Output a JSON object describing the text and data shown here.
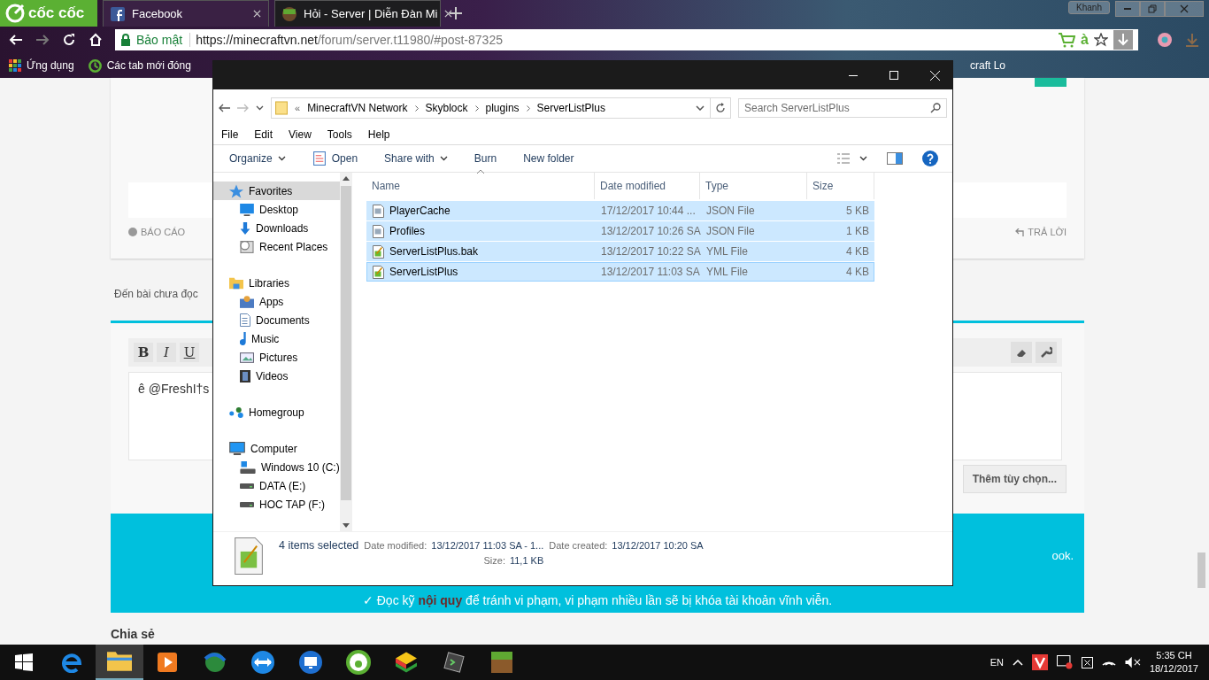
{
  "browser": {
    "brand": "cốc cốc",
    "tabs": [
      {
        "label": "Facebook",
        "kind": "facebook",
        "selected": false
      },
      {
        "label": "Hỏi - Server | Diễn Đàn Mi",
        "kind": "grass",
        "selected": true
      }
    ],
    "user": "Khanh",
    "security_label": "Bảo mật",
    "url_host": "https://minecraftvn.net",
    "url_path": "/forum/server.t11980/#post-87325",
    "addon_text": "à",
    "bookmarks": [
      {
        "label": "Ứng dụng",
        "kind": "apps"
      },
      {
        "label": "Các tab mới đóng",
        "kind": "history"
      },
      {
        "label": "craft Lo",
        "kind": "plain"
      }
    ]
  },
  "page": {
    "report": "BÁO CÁO",
    "reply": "TRẢ LỜI",
    "unread": "Đến bài chưa đọc",
    "editor_buttons": [
      "B",
      "I",
      "U"
    ],
    "editor_text": "ê @FreshI†s",
    "more_options": "Thêm tùy chọn...",
    "notice_tail": "ook.",
    "rules": "✓ Đọc kỹ **nội quy** để tránh vi phạm, vi phạm nhiều lần sẽ bị khóa tài khoản vĩnh viễn.",
    "share": "Chia sẻ"
  },
  "explorer": {
    "breadcrumb_prefix": "«",
    "breadcrumb": [
      "MinecraftVN Network",
      "Skyblock",
      "plugins",
      "ServerListPlus"
    ],
    "search": {
      "placeholder": "Search ServerListPlus"
    },
    "menu": [
      "File",
      "Edit",
      "View",
      "Tools",
      "Help"
    ],
    "toolbar": [
      {
        "label": "Organize",
        "dropdown": true,
        "kind": "plain"
      },
      {
        "label": "Open",
        "dropdown": false,
        "kind": "open"
      },
      {
        "label": "Share with",
        "dropdown": true,
        "kind": "plain"
      },
      {
        "label": "Burn",
        "dropdown": false,
        "kind": "plain"
      },
      {
        "label": "New folder",
        "dropdown": false,
        "kind": "plain"
      }
    ],
    "nav": [
      {
        "label": "Favorites",
        "kind": "star",
        "selected": true,
        "children": [
          {
            "label": "Desktop",
            "kind": "desktop",
            "selected": false
          },
          {
            "label": "Downloads",
            "kind": "download",
            "selected": false
          },
          {
            "label": "Recent Places",
            "kind": "recent",
            "selected": false
          }
        ]
      },
      {
        "label": "Libraries",
        "kind": "library",
        "selected": false,
        "children": [
          {
            "label": "Apps",
            "kind": "apps",
            "selected": false
          },
          {
            "label": "Documents",
            "kind": "document",
            "selected": false
          },
          {
            "label": "Music",
            "kind": "music",
            "selected": false
          },
          {
            "label": "Pictures",
            "kind": "picture",
            "selected": false
          },
          {
            "label": "Videos",
            "kind": "video",
            "selected": false
          }
        ]
      },
      {
        "label": "Homegroup",
        "kind": "homegroup",
        "selected": false
      },
      {
        "label": "Computer",
        "kind": "computer",
        "selected": false,
        "children": [
          {
            "label": "Windows 10 (C:)",
            "kind": "windrive",
            "selected": false
          },
          {
            "label": "DATA (E:)",
            "kind": "drive",
            "selected": false
          },
          {
            "label": "HOC TAP (F:)",
            "kind": "drive",
            "selected": false
          }
        ]
      }
    ],
    "columns": [
      "Name",
      "Date modified",
      "Type",
      "Size"
    ],
    "files": [
      {
        "name": "PlayerCache",
        "date": "17/12/2017 10:44 ...",
        "type": "JSON File",
        "size": "5 KB",
        "kind": "json",
        "selected": true
      },
      {
        "name": "Profiles",
        "date": "13/12/2017 10:26 SA",
        "type": "JSON File",
        "size": "1 KB",
        "kind": "json",
        "selected": true
      },
      {
        "name": "ServerListPlus.bak",
        "date": "13/12/2017 10:22 SA",
        "type": "YML File",
        "size": "4 KB",
        "kind": "yml",
        "selected": true
      },
      {
        "name": "ServerListPlus",
        "date": "13/12/2017 11:03 SA",
        "type": "YML File",
        "size": "4 KB",
        "kind": "yml",
        "selected": true
      }
    ],
    "status": {
      "count": "4 items selected",
      "fields": [
        {
          "label": "Date modified:",
          "value": "13/12/2017 11:03 SA - 1..."
        },
        {
          "label": "Date created:",
          "value": "13/12/2017 10:20 SA"
        },
        {
          "label": "Size:",
          "value": "11,1 KB"
        }
      ]
    }
  },
  "taskbar": {
    "apps": [
      {
        "kind": "edge",
        "active": false
      },
      {
        "kind": "folder",
        "active": true
      },
      {
        "kind": "player",
        "active": false
      },
      {
        "kind": "globe",
        "active": false
      },
      {
        "kind": "remote",
        "active": false
      },
      {
        "kind": "monitor",
        "active": false
      },
      {
        "kind": "coccoc",
        "active": false
      },
      {
        "kind": "stack",
        "active": false
      },
      {
        "kind": "terminal",
        "active": false
      },
      {
        "kind": "block",
        "active": false
      }
    ],
    "language": "EN",
    "time": "5:35 CH",
    "date": "18/12/2017"
  }
}
